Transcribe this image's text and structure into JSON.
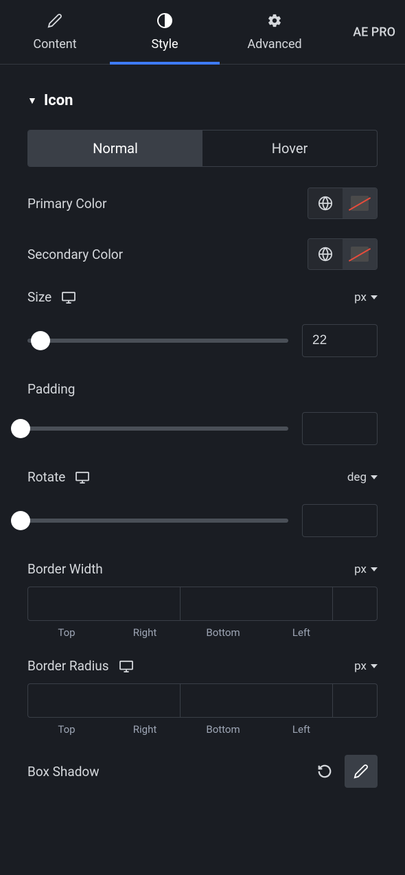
{
  "header": {
    "ae_pro": "AE PRO"
  },
  "tabs": {
    "content": "Content",
    "style": "Style",
    "advanced": "Advanced"
  },
  "section": {
    "title": "Icon"
  },
  "state_tabs": {
    "normal": "Normal",
    "hover": "Hover"
  },
  "controls": {
    "primary_color": "Primary Color",
    "secondary_color": "Secondary Color",
    "size": "Size",
    "size_unit": "px",
    "size_value": "22",
    "padding": "Padding",
    "padding_value": "",
    "rotate": "Rotate",
    "rotate_unit": "deg",
    "rotate_value": "",
    "border_width": "Border Width",
    "border_width_unit": "px",
    "border_radius": "Border Radius",
    "border_radius_unit": "px",
    "box_shadow": "Box Shadow"
  },
  "dims": {
    "top": "Top",
    "right": "Right",
    "bottom": "Bottom",
    "left": "Left"
  }
}
